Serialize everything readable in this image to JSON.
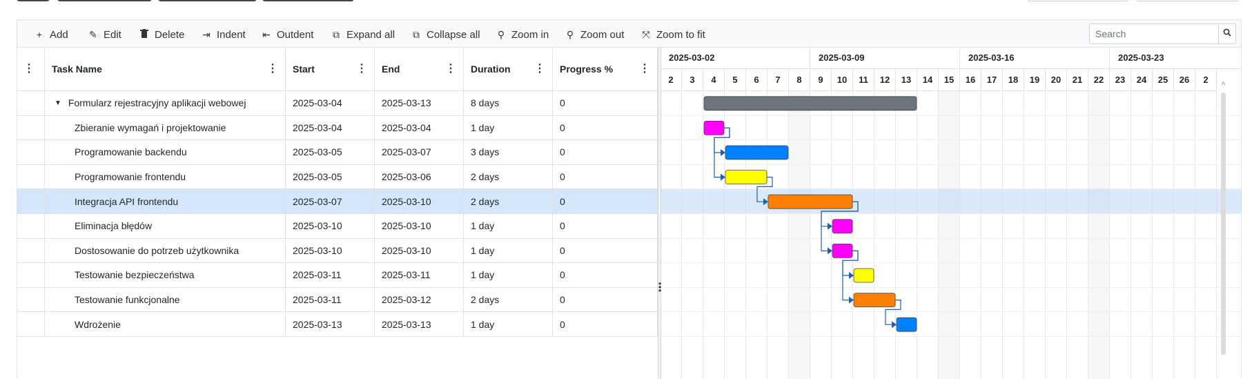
{
  "toolbar": {
    "items": [
      {
        "icon": "plus-icon",
        "label": "Add"
      },
      {
        "icon": "pencil-icon",
        "label": "Edit"
      },
      {
        "icon": "trash-icon",
        "label": "Delete"
      },
      {
        "icon": "indent-icon",
        "label": "Indent"
      },
      {
        "icon": "outdent-icon",
        "label": "Outdent"
      },
      {
        "icon": "expand-all-icon",
        "label": "Expand all"
      },
      {
        "icon": "collapse-all-icon",
        "label": "Collapse all"
      },
      {
        "icon": "zoom-in-icon",
        "label": "Zoom in"
      },
      {
        "icon": "zoom-out-icon",
        "label": "Zoom out"
      },
      {
        "icon": "zoom-to-fit-icon",
        "label": "Zoom to fit"
      }
    ],
    "search_placeholder": "Search"
  },
  "grid": {
    "columns": [
      "Task Name",
      "Start",
      "End",
      "Duration",
      "Progress %"
    ],
    "rows": [
      {
        "name": "Formularz rejestracyjny aplikacji webowej",
        "start": "2025-03-04",
        "end": "2025-03-13",
        "duration": "8 days",
        "progress": "0",
        "parent": true
      },
      {
        "name": "Zbieranie wymagań i projektowanie",
        "start": "2025-03-04",
        "end": "2025-03-04",
        "duration": "1 day",
        "progress": "0"
      },
      {
        "name": "Programowanie backendu",
        "start": "2025-03-05",
        "end": "2025-03-07",
        "duration": "3 days",
        "progress": "0"
      },
      {
        "name": "Programowanie frontendu",
        "start": "2025-03-05",
        "end": "2025-03-06",
        "duration": "2 days",
        "progress": "0"
      },
      {
        "name": "Integracja API frontendu",
        "start": "2025-03-07",
        "end": "2025-03-10",
        "duration": "2 days",
        "progress": "0",
        "selected": true
      },
      {
        "name": "Eliminacja błędów",
        "start": "2025-03-10",
        "end": "2025-03-10",
        "duration": "1 day",
        "progress": "0"
      },
      {
        "name": "Dostosowanie do potrzeb użytkownika",
        "start": "2025-03-10",
        "end": "2025-03-10",
        "duration": "1 day",
        "progress": "0"
      },
      {
        "name": "Testowanie bezpieczeństwa",
        "start": "2025-03-11",
        "end": "2025-03-11",
        "duration": "1 day",
        "progress": "0"
      },
      {
        "name": "Testowanie funkcjonalne",
        "start": "2025-03-11",
        "end": "2025-03-12",
        "duration": "2 days",
        "progress": "0"
      },
      {
        "name": "Wdrożenie",
        "start": "2025-03-13",
        "end": "2025-03-13",
        "duration": "1 day",
        "progress": "0"
      }
    ]
  },
  "timeline": {
    "weeks": [
      "2025-03-02",
      "2025-03-09",
      "2025-03-16",
      "2025-03-23"
    ],
    "days": [
      "2",
      "3",
      "4",
      "5",
      "6",
      "7",
      "8",
      "9",
      "10",
      "11",
      "12",
      "13",
      "14",
      "15",
      "16",
      "17",
      "18",
      "19",
      "20",
      "21",
      "22",
      "23",
      "24",
      "25",
      "26",
      "2"
    ],
    "bars": [
      {
        "row": 0,
        "from_day": 4,
        "to_day": 13,
        "color": "#6c757d"
      },
      {
        "row": 1,
        "from_day": 4,
        "to_day": 4,
        "color": "#ff00ff"
      },
      {
        "row": 2,
        "from_day": 5,
        "to_day": 7,
        "color": "#0080ff"
      },
      {
        "row": 3,
        "from_day": 5,
        "to_day": 6,
        "color": "#ffff00"
      },
      {
        "row": 4,
        "from_day": 7,
        "to_day": 10,
        "color": "#ff8000"
      },
      {
        "row": 5,
        "from_day": 10,
        "to_day": 10,
        "color": "#ff00ff"
      },
      {
        "row": 6,
        "from_day": 10,
        "to_day": 10,
        "color": "#ff00ff"
      },
      {
        "row": 7,
        "from_day": 11,
        "to_day": 11,
        "color": "#ffff00"
      },
      {
        "row": 8,
        "from_day": 11,
        "to_day": 12,
        "color": "#ff8000"
      },
      {
        "row": 9,
        "from_day": 13,
        "to_day": 13,
        "color": "#0080ff"
      }
    ],
    "links": [
      [
        1,
        2
      ],
      [
        1,
        3
      ],
      [
        3,
        4
      ],
      [
        4,
        5
      ],
      [
        4,
        6
      ],
      [
        6,
        7
      ],
      [
        6,
        8
      ],
      [
        8,
        9
      ]
    ],
    "link_color": "#1f5fa8"
  }
}
